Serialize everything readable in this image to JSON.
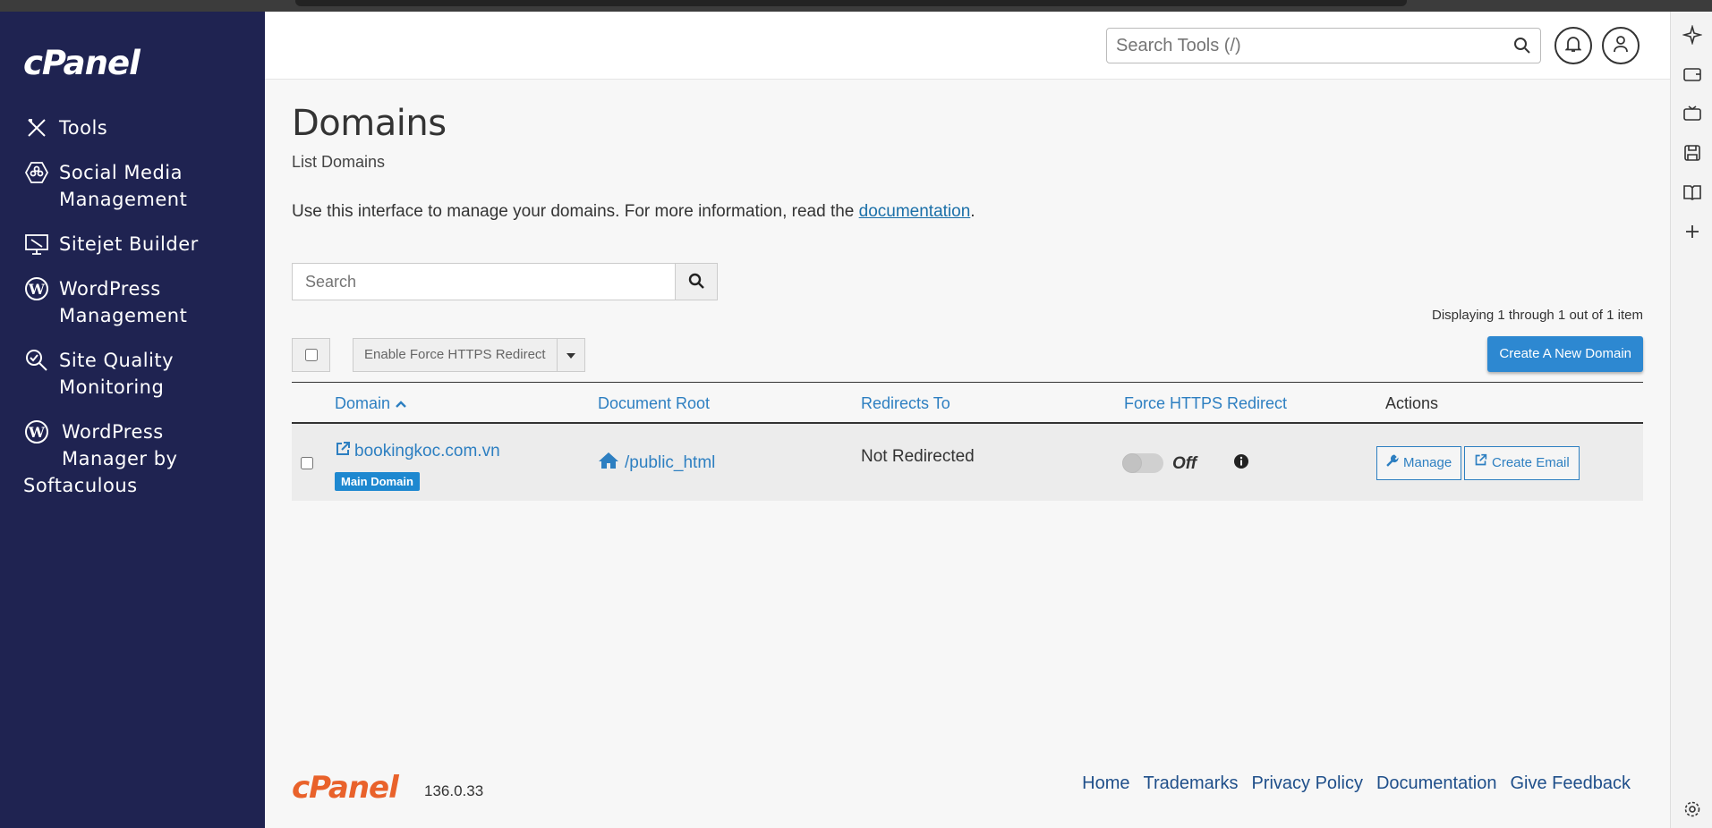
{
  "sidebar": {
    "logo": "cPanel",
    "items": [
      {
        "label": "Tools"
      },
      {
        "label": "Social Media Management"
      },
      {
        "label": "Sitejet Builder"
      },
      {
        "label": "WordPress Management"
      },
      {
        "label": "Site Quality Monitoring"
      },
      {
        "label_line1": "WordPress",
        "label_line2": "Manager by",
        "label_line3": "Softaculous"
      }
    ],
    "social_l1": "Social Media",
    "social_l2": "Management",
    "wp_l1": "WordPress",
    "wp_l2": "Management",
    "sq_l1": "Site Quality",
    "sq_l2": "Monitoring"
  },
  "topbar": {
    "search_placeholder": "Search Tools (/)"
  },
  "page": {
    "title": "Domains",
    "subtitle": "List Domains",
    "intro_text": "Use this interface to manage your domains. For more information, read the ",
    "intro_link": "documentation",
    "intro_end": "."
  },
  "search": {
    "placeholder": "Search"
  },
  "paging": {
    "displaying": "Displaying 1 through 1 out of 1 item"
  },
  "toolbar": {
    "bulk_action": "Enable Force HTTPS Redirect",
    "create_label": "Create A New Domain"
  },
  "table": {
    "headers": {
      "domain": "Domain",
      "docroot": "Document Root",
      "redirects": "Redirects To",
      "https": "Force HTTPS Redirect",
      "actions": "Actions"
    },
    "rows": [
      {
        "domain": "bookingkoc.com.vn",
        "badge": "Main Domain",
        "docroot": "/public_html",
        "redirects": "Not Redirected",
        "https_state": "Off",
        "manage": "Manage",
        "create_email": "Create Email"
      }
    ]
  },
  "footer": {
    "logo": "cPanel",
    "version": "136.0.33",
    "links": [
      "Home",
      "Trademarks",
      "Privacy Policy",
      "Documentation",
      "Give Feedback"
    ]
  },
  "colors": {
    "sidebar_bg": "#1f2351",
    "link_blue": "#2d7fc1",
    "primary_button": "#2d88d1",
    "footer_logo": "#e9622b"
  }
}
